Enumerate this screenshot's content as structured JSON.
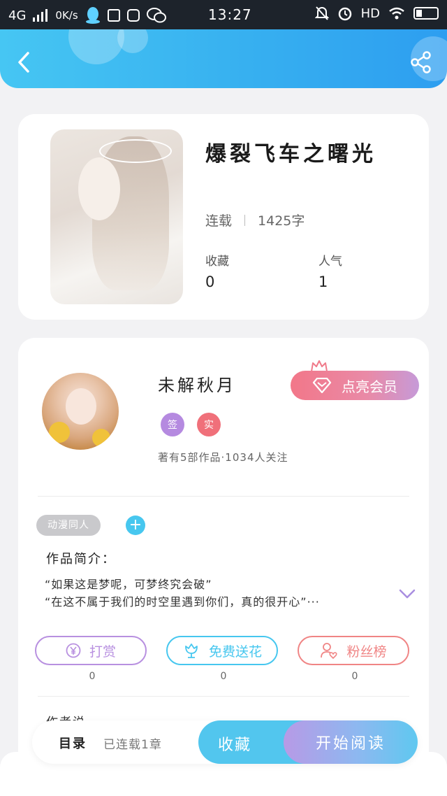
{
  "status_bar": {
    "network": "4G",
    "speed": "0K/s",
    "time": "13:27",
    "hd": "HD"
  },
  "header": {
    "back_icon": "back-arrow-icon",
    "share_icon": "share-icon",
    "gradient": [
      "#46c6f3",
      "#2d9ef0"
    ]
  },
  "book": {
    "title": "爆裂飞车之曙光",
    "status": "连载",
    "word_count": "1425字",
    "stats": [
      {
        "label": "收藏",
        "value": "0"
      },
      {
        "label": "人气",
        "value": "1"
      }
    ]
  },
  "author": {
    "name": "未解秋月",
    "vip_button": "点亮会员",
    "badges": [
      {
        "text": "签",
        "color": "#b58ae0"
      },
      {
        "text": "实",
        "color": "#f0707a"
      }
    ],
    "meta": "著有5部作品·1034人关注"
  },
  "tags": {
    "items": [
      "动漫同人"
    ],
    "add_label": "+"
  },
  "intro": {
    "title": "作品简介：",
    "lines": [
      "“如果这是梦呢，可梦终究会破”",
      "“在这不属于我们的时空里遇到你们，真的很开心”···"
    ]
  },
  "actions": [
    {
      "label": "打赏",
      "count": "0",
      "color": "#b890e0",
      "icon": "yen-coin-icon"
    },
    {
      "label": "免费送花",
      "count": "0",
      "color": "#47c7ef",
      "icon": "flower-icon"
    },
    {
      "label": "粉丝榜",
      "count": "0",
      "color": "#f08585",
      "icon": "fan-user-icon"
    }
  ],
  "author_says": "作者说",
  "bottom_bar": {
    "toc": "目录",
    "toc_info": "已连载1章",
    "collect": "收藏",
    "read": "开始阅读"
  }
}
